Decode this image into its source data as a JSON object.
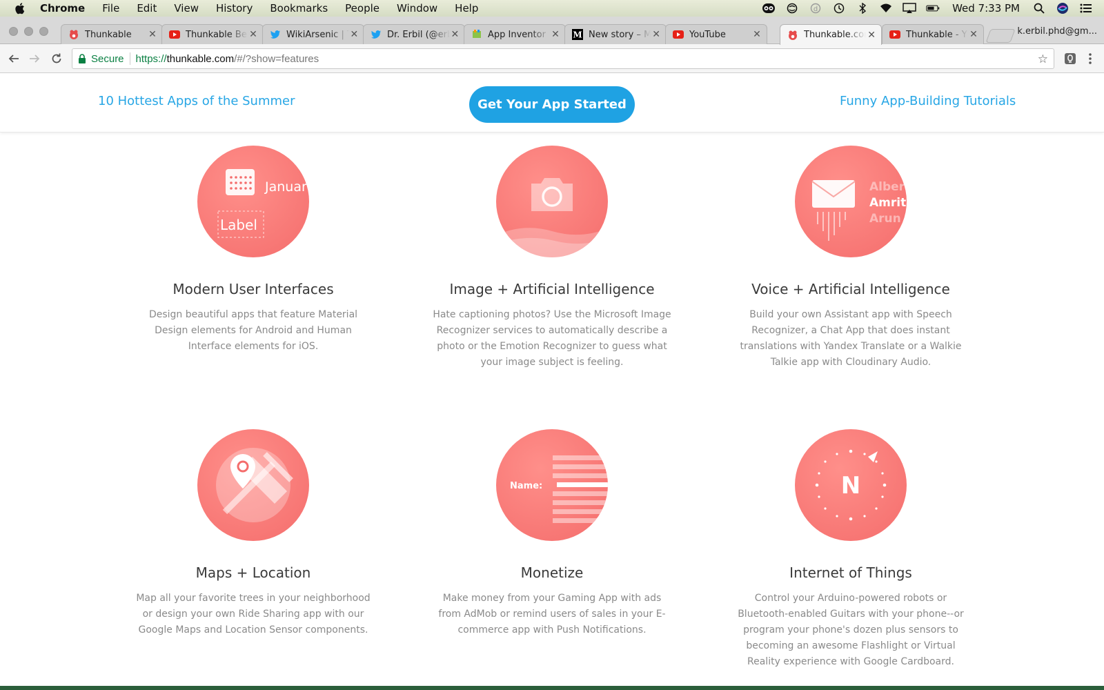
{
  "menubar": {
    "app": "Chrome",
    "items": [
      "File",
      "Edit",
      "View",
      "History",
      "Bookmarks",
      "People",
      "Window",
      "Help"
    ],
    "clock": "Wed 7:33 PM"
  },
  "tabs": [
    {
      "title": "Thunkable",
      "favicon": "thunkable-icon",
      "active": false
    },
    {
      "title": "Thunkable Be",
      "favicon": "youtube-icon",
      "active": false
    },
    {
      "title": "WikiArsenic | T",
      "favicon": "twitter-icon",
      "active": false
    },
    {
      "title": "Dr. Erbil (@erb",
      "favicon": "twitter-icon",
      "active": false
    },
    {
      "title": "App Inventor",
      "favicon": "appinventor-icon",
      "active": false
    },
    {
      "title": "New story – M",
      "favicon": "medium-icon",
      "active": false
    },
    {
      "title": "YouTube",
      "favicon": "youtube-icon",
      "active": false
    },
    {
      "title": "Thunkable.cor",
      "favicon": "thunkable-icon",
      "active": true
    },
    {
      "title": "Thunkable - Y",
      "favicon": "youtube-icon",
      "active": false
    }
  ],
  "profile": "k.erbil.phd@gm...",
  "omnibox": {
    "secure_label": "Secure",
    "scheme": "https://",
    "host": "thunkable.com",
    "path": "/#/?show=features"
  },
  "subnav": {
    "left_link": "10 Hottest Apps of the Summer",
    "cta": "Get Your App Started",
    "right_link": "Funny App-Building Tutorials"
  },
  "features": [
    {
      "title": "Modern User Interfaces",
      "desc": "Design beautiful apps that feature Material Design elements for Android and Human Interface elements for iOS.",
      "art": {
        "month": "Januar",
        "label": "Label"
      }
    },
    {
      "title": "Image + Artificial Intelligence",
      "desc": "Hate captioning photos? Use the Microsoft Image Recognizer services to automatically describe a photo or the Emotion Recognizer to guess what your image subject is feeling."
    },
    {
      "title": "Voice + Artificial Intelligence",
      "desc": "Build your own Assistant app with Speech Recognizer, a Chat App that does instant translations with Yandex Translate or a Walkie Talkie app with Cloudinary Audio.",
      "art": {
        "names": [
          "Albert",
          "Amrita",
          "Arun"
        ]
      }
    },
    {
      "title": "Maps + Location",
      "desc": "Map all your favorite trees in your neighborhood or design your own Ride Sharing app with our Google Maps and Location Sensor components."
    },
    {
      "title": "Monetize",
      "desc": "Make money from your Gaming App with ads from AdMob or remind users of sales in your E-commerce app with Push Notifications.",
      "art": {
        "field_label": "Name:"
      }
    },
    {
      "title": "Internet of Things",
      "desc": "Control your Arduino-powered robots or Bluetooth-enabled Guitars with your phone--or program your phone's dozen plus sensors to becoming an awesome Flashlight or Virtual Reality experience with Google Cardboard.",
      "art": {
        "compass_letter": "N"
      }
    }
  ],
  "colors": {
    "accent": "#1fa2e3",
    "feature_circle": "#f67471",
    "link": "#27a6e5"
  }
}
